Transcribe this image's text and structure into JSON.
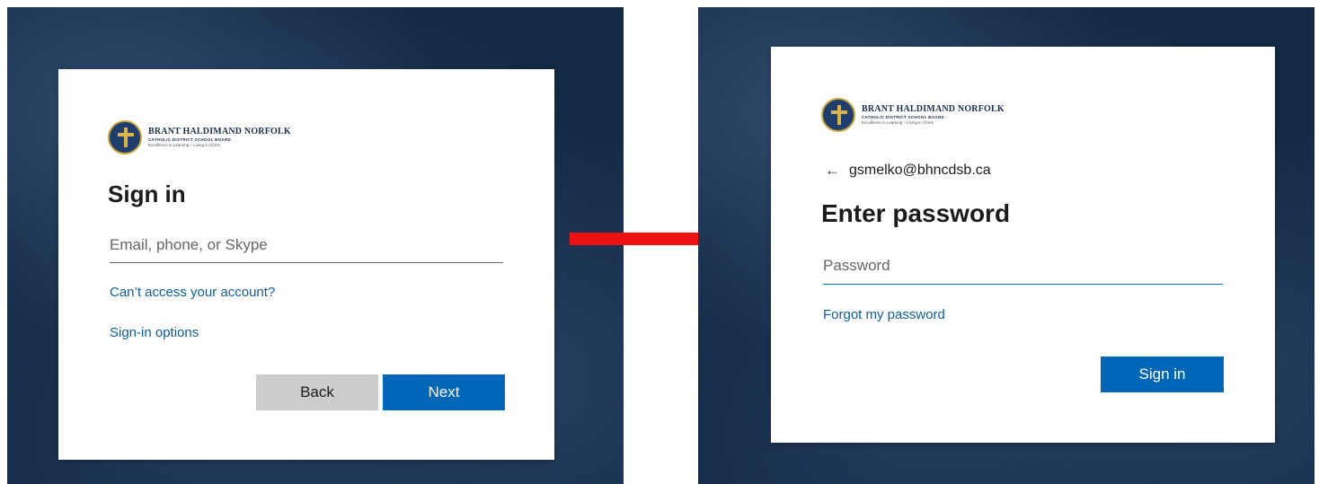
{
  "colors": {
    "accent": "#0067b8",
    "link": "#0f5e9c",
    "secondary_button": "#cccccc",
    "background": "#132a45",
    "flow_arrow": "#ee1111"
  },
  "logo": {
    "name": "BRANT HALDIMAND NORFOLK",
    "subtitle": "CATHOLIC DISTRICT SCHOOL BOARD",
    "tagline": "Excellence in Learning – Living in Christ",
    "icon": "school-board-seal-icon"
  },
  "signin_screen": {
    "title": "Sign in",
    "email_placeholder": "Email, phone, or Skype",
    "email_value": "",
    "cant_access_link": "Can’t access your account?",
    "signin_options_link": "Sign-in options",
    "back_button": "Back",
    "next_button": "Next"
  },
  "flow_arrow": {
    "icon": "right-arrow-icon"
  },
  "password_screen": {
    "back_arrow": "←",
    "account": "gsmelko@bhncdsb.ca",
    "title": "Enter password",
    "password_placeholder": "Password",
    "password_value": "",
    "forgot_link": "Forgot my password",
    "signin_button": "Sign in"
  }
}
